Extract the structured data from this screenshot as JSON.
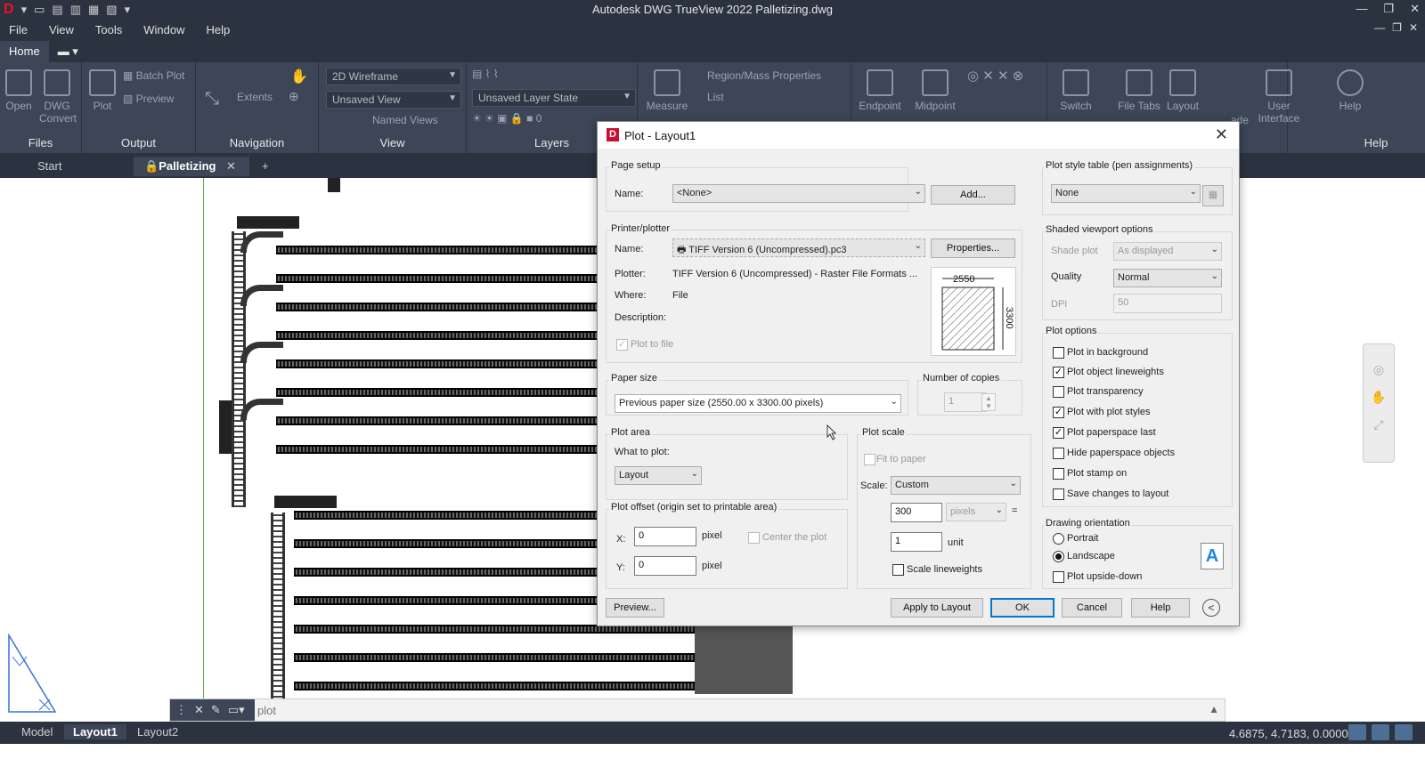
{
  "window": {
    "title": "Autodesk DWG TrueView 2022    Palletizing.dwg"
  },
  "menu": [
    "File",
    "View",
    "Tools",
    "Window",
    "Help"
  ],
  "ribbon_tabs": [
    "Home"
  ],
  "ribbon": {
    "files": {
      "label": "Files",
      "open": "Open",
      "dwg_convert_1": "DWG",
      "dwg_convert_2": "Convert"
    },
    "output": {
      "label": "Output",
      "plot": "Plot",
      "batch_plot": "Batch Plot",
      "preview": "Preview"
    },
    "navigation": {
      "label": "Navigation",
      "extents": "Extents"
    },
    "view": {
      "label": "View",
      "visual_style": "2D Wireframe",
      "saved_view": "Unsaved View",
      "named_views": "Named Views"
    },
    "layers": {
      "label": "Layers",
      "layer_state": "Unsaved Layer State",
      "layer_value": "0"
    },
    "measure": {
      "measure": "Measure",
      "region_mass": "Region/Mass Properties",
      "list": "List"
    },
    "osnap": {
      "endpoint": "Endpoint",
      "midpoint": "Midpoint"
    },
    "ui": {
      "switch": "Switch",
      "file_tabs": "File Tabs",
      "layout": "Layout",
      "cascade": "ade",
      "user_interface_1": "User",
      "user_interface_2": "Interface",
      "help_btn": "Help",
      "help_label": "Help"
    }
  },
  "doc_tabs": {
    "start": "Start",
    "active": "Palletizing",
    "close": "✕",
    "add": "+"
  },
  "command_line": {
    "text": "plot"
  },
  "layout_tabs": [
    "Model",
    "Layout1",
    "Layout2"
  ],
  "status": {
    "coordinates": "4.6875, 4.7183, 0.0000"
  },
  "dialog": {
    "title": "Plot - Layout1",
    "page_setup": {
      "group": "Page setup",
      "name_label": "Name:",
      "name_value": "<None>",
      "add_button": "Add..."
    },
    "printer": {
      "group": "Printer/plotter",
      "name_label": "Name:",
      "name_value": "TIFF Version 6 (Uncompressed).pc3",
      "properties_button": "Properties...",
      "plotter_label": "Plotter:",
      "plotter_value": "TIFF Version 6 (Uncompressed) - Raster File Formats ...",
      "where_label": "Where:",
      "where_value": "File",
      "description_label": "Description:",
      "plot_to_file": "Plot to file",
      "preview_width": "2550",
      "preview_height": "3300"
    },
    "paper_size": {
      "group": "Paper size",
      "value": "Previous paper size  (2550.00 x 3300.00 pixels)"
    },
    "copies": {
      "group": "Number of copies",
      "value": "1"
    },
    "plot_area": {
      "group": "Plot area",
      "what_label": "What to plot:",
      "what_value": "Layout"
    },
    "plot_scale": {
      "group": "Plot scale",
      "fit_to_paper": "Fit to paper",
      "scale_label": "Scale:",
      "scale_value": "Custom",
      "value1": "300",
      "unit1": "pixels",
      "equals": "=",
      "value2": "1",
      "unit2": "unit",
      "scale_lineweights": "Scale lineweights"
    },
    "plot_offset": {
      "group": "Plot offset (origin set to printable area)",
      "x_label": "X:",
      "x_value": "0",
      "x_unit": "pixel",
      "y_label": "Y:",
      "y_value": "0",
      "y_unit": "pixel",
      "center": "Center the plot"
    },
    "style_table": {
      "group": "Plot style table (pen assignments)",
      "value": "None"
    },
    "shaded": {
      "group": "Shaded viewport options",
      "shade_label": "Shade plot",
      "shade_value": "As displayed",
      "quality_label": "Quality",
      "quality_value": "Normal",
      "dpi_label": "DPI",
      "dpi_value": "50"
    },
    "plot_options": {
      "group": "Plot options",
      "items": [
        {
          "label": "Plot in background",
          "checked": false
        },
        {
          "label": "Plot object lineweights",
          "checked": true
        },
        {
          "label": "Plot transparency",
          "checked": false
        },
        {
          "label": "Plot with plot styles",
          "checked": true
        },
        {
          "label": "Plot paperspace last",
          "checked": true
        },
        {
          "label": "Hide paperspace objects",
          "checked": false
        },
        {
          "label": "Plot stamp on",
          "checked": false
        },
        {
          "label": "Save changes to layout",
          "checked": false
        }
      ]
    },
    "orientation": {
      "group": "Drawing orientation",
      "portrait": "Portrait",
      "landscape": "Landscape",
      "upside_down": "Plot upside-down",
      "glyph": "A"
    },
    "buttons": {
      "preview": "Preview...",
      "apply": "Apply to Layout",
      "ok": "OK",
      "cancel": "Cancel",
      "help": "Help",
      "expand": "<"
    }
  }
}
